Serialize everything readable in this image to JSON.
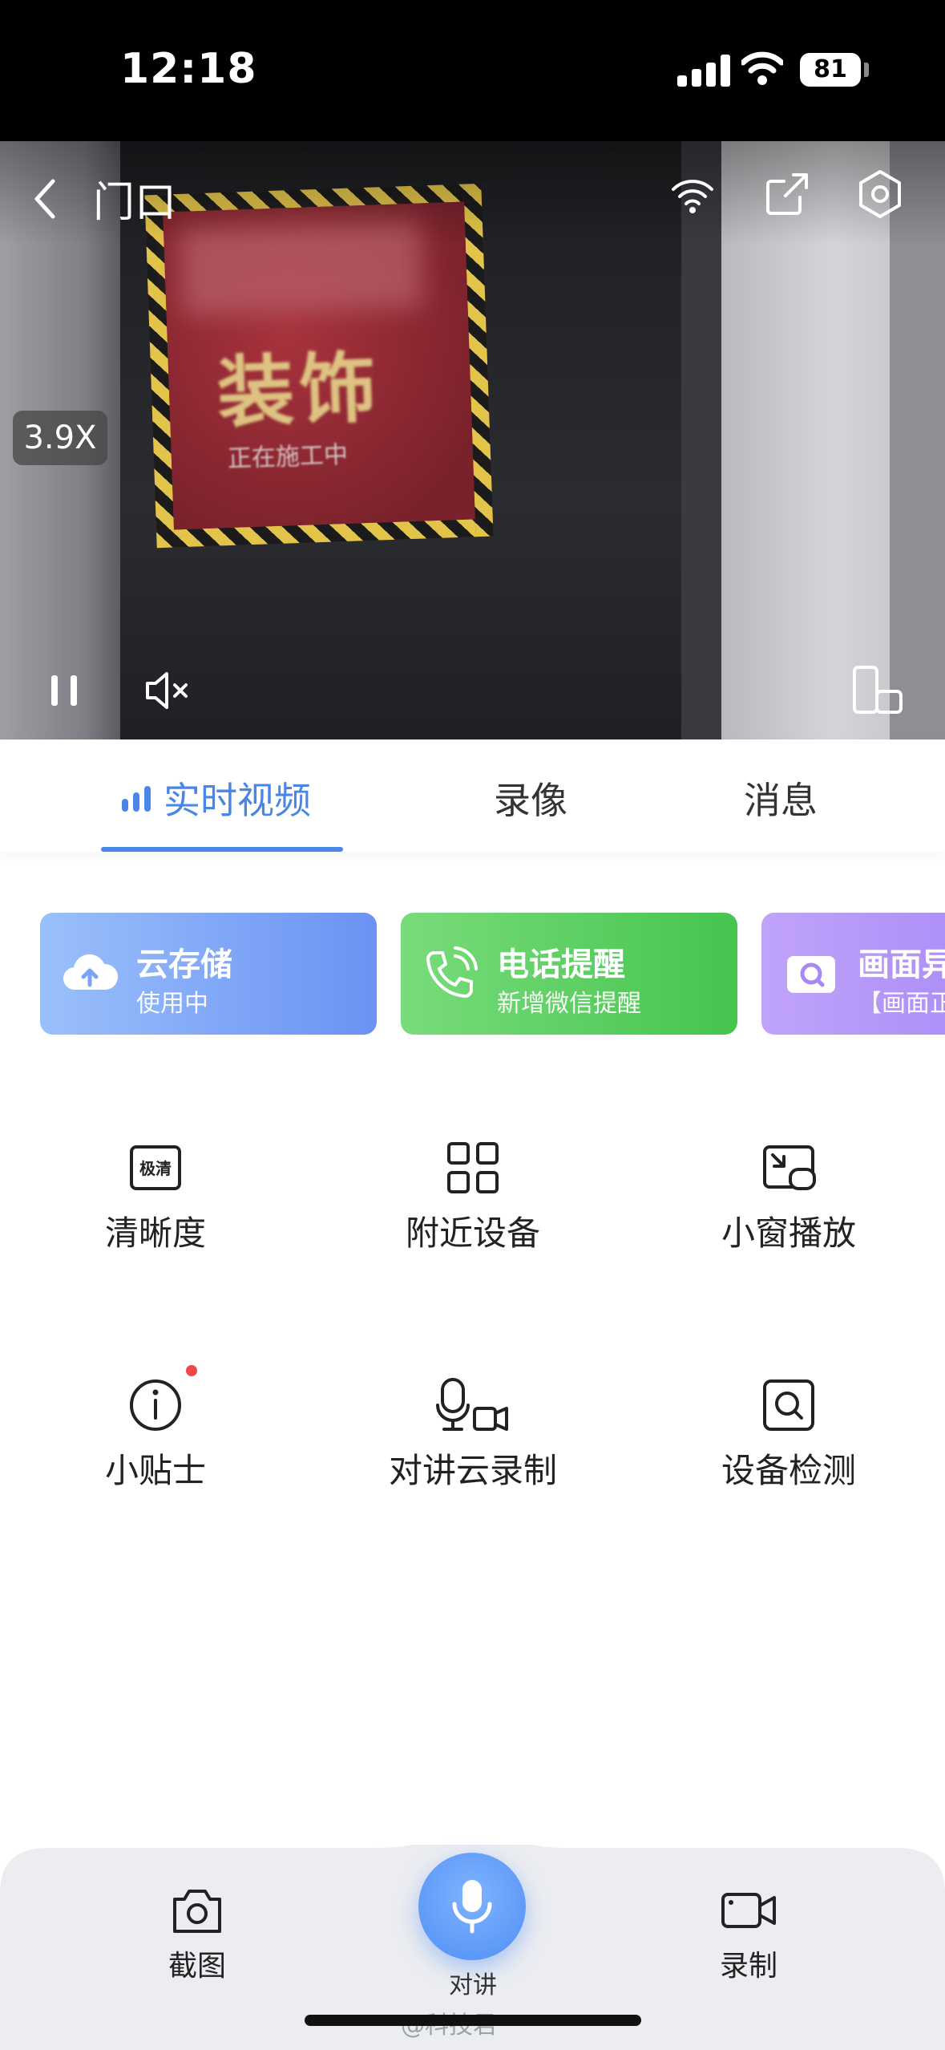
{
  "status_bar": {
    "time": "12:18",
    "battery": "81"
  },
  "video": {
    "title": "门口",
    "zoom": "3.9X",
    "poster_big_text": "装饰",
    "poster_small_text": "正在施工中"
  },
  "tabs": [
    {
      "label": "实时视频",
      "active": true
    },
    {
      "label": "录像",
      "active": false
    },
    {
      "label": "消息",
      "active": false
    }
  ],
  "cards": [
    {
      "title": "云存储",
      "subtitle": "使用中",
      "icon": "cloud-upload-icon"
    },
    {
      "title": "电话提醒",
      "subtitle": "新增微信提醒",
      "icon": "phone-ring-icon"
    },
    {
      "title": "画面异",
      "subtitle": "【画面正",
      "icon": "camera-icon"
    }
  ],
  "grid": [
    {
      "label": "清晰度",
      "icon": "hd-quality-icon",
      "icon_text": "极清"
    },
    {
      "label": "附近设备",
      "icon": "grid-icon"
    },
    {
      "label": "小窗播放",
      "icon": "picture-in-picture-icon"
    },
    {
      "label": "小贴士",
      "icon": "info-icon",
      "badge": true
    },
    {
      "label": "对讲云录制",
      "icon": "mic-camera-icon"
    },
    {
      "label": "设备检测",
      "icon": "device-scan-icon"
    }
  ],
  "dock": {
    "screenshot_label": "截图",
    "talk_label": "对讲",
    "record_label": "录制"
  },
  "watermark": "@科技君",
  "colors": {
    "accent": "#4a86e8",
    "green": "#45c44e",
    "purple": "#a080f4",
    "badge": "#f04848"
  }
}
